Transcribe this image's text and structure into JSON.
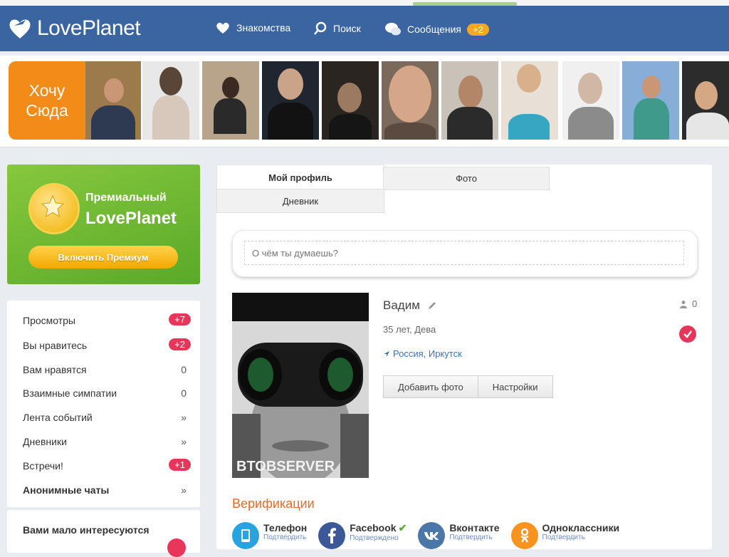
{
  "header": {
    "logo_text": "LovePlanet",
    "nav": [
      {
        "label": "Знакомства",
        "icon": "heart-icon"
      },
      {
        "label": "Поиск",
        "icon": "search-icon"
      },
      {
        "label": "Сообщения",
        "icon": "chat-icon"
      }
    ],
    "messages_badge": "+2"
  },
  "strip": {
    "want_here_line1": "Хочу",
    "want_here_line2": "Сюда"
  },
  "premium": {
    "line1": "Премиальный",
    "line2": "LovePlanet",
    "button": "Включить Премиум"
  },
  "sidebar": {
    "items": [
      {
        "label": "Просмотры",
        "value": "+7",
        "pill": true
      },
      {
        "label": "Вы нравитесь",
        "value": "+2",
        "pill": true
      },
      {
        "label": "Вам нравятся",
        "value": "0",
        "pill": false
      },
      {
        "label": "Взаимные симпатии",
        "value": "0",
        "pill": false
      },
      {
        "label": "Лента событий",
        "value": "»",
        "pill": false
      },
      {
        "label": "Дневники",
        "value": "»",
        "pill": false
      },
      {
        "label": "Встречи!",
        "value": "+1",
        "pill": true
      },
      {
        "label": "Анонимные чаты",
        "value": "»",
        "pill": false
      }
    ],
    "bottom_title": "Вами мало интересуются"
  },
  "profile": {
    "tabs": [
      "Мой профиль",
      "Фото",
      "Дневник"
    ],
    "status_placeholder": "О чём ты думаешь?",
    "name": "Вадим",
    "age": "35 лет, Дева",
    "location": "Россия, Иркутск",
    "add_photo": "Добавить фото",
    "settings": "Настройки",
    "counter": "0",
    "avatar_watermark": "BTOBSERVER",
    "verification_title": "Верификации",
    "verifications": [
      {
        "label": "Телефон",
        "sub": "Подтвердить",
        "color": "#29a3e0",
        "icon": "phone-icon"
      },
      {
        "label": "Facebook",
        "sub": "Подтверждено",
        "color": "#3b5998",
        "icon": "facebook-icon"
      },
      {
        "label": "Вконтакте",
        "sub": "Подтвердить",
        "color": "#4a76a8",
        "icon": "vk-icon"
      },
      {
        "label": "Одноклассники",
        "sub": "Подтвердить",
        "color": "#f7931e",
        "icon": "ok-icon"
      }
    ]
  },
  "colors": {
    "header": "#3a65a0",
    "accent_pink": "#e8355a",
    "premium_green": "#6bb830",
    "orange": "#f28b18"
  }
}
